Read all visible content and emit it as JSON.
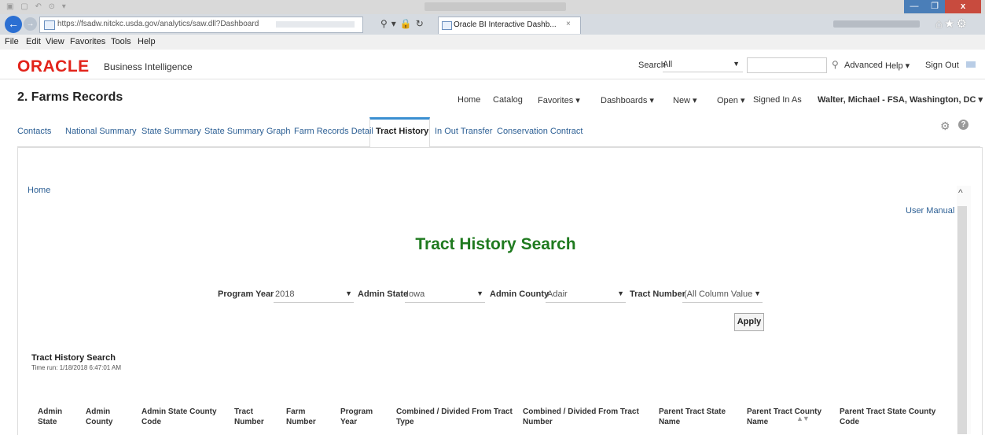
{
  "window": {
    "close_glyph": "x"
  },
  "browser": {
    "url": "https://fsadw.nitckc.usda.gov/analytics/saw.dll?Dashboard",
    "tab_title": "Oracle BI Interactive Dashb...",
    "tab_close": "×"
  },
  "menu": [
    "File",
    "Edit",
    "View",
    "Favorites",
    "Tools",
    "Help"
  ],
  "header": {
    "logo": "ORACLE",
    "product": "Business Intelligence",
    "search_label": "Search",
    "search_scope": "All",
    "advanced": "Advanced",
    "help": "Help ▾",
    "sign_out": "Sign Out"
  },
  "dashboard": {
    "title": "2. Farms Records",
    "nav": {
      "home": "Home",
      "catalog": "Catalog",
      "favorites": "Favorites ▾",
      "dashboards": "Dashboards ▾",
      "new": "New ▾",
      "open": "Open ▾",
      "signed_in_as": "Signed In As",
      "user": "Walter, Michael - FSA, Washington, DC ▾"
    },
    "tabs": [
      "Contacts",
      "National Summary",
      "State Summary",
      "State Summary Graph",
      "Farm Records Detail",
      "Tract History",
      "In Out Transfer",
      "Conservation Contract"
    ],
    "active_tab": "Tract History"
  },
  "content": {
    "breadcrumb": "Home",
    "user_manual": "User Manual",
    "page_title": "Tract History Search",
    "prompts": {
      "program_year_label": "Program Year",
      "program_year_value": "2018",
      "admin_state_label": "Admin State",
      "admin_state_value": "Iowa",
      "admin_county_label": "Admin County",
      "admin_county_value": "Adair",
      "tract_number_label": "Tract Number",
      "tract_number_value": "(All Column Value"
    },
    "apply": "Apply",
    "result_title": "Tract History Search",
    "time_run": "Time run: 1/18/2018 6:47:01 AM",
    "table_headers": [
      [
        "Admin",
        "State"
      ],
      [
        "Admin",
        "County"
      ],
      [
        "Admin State County",
        "Code"
      ],
      [
        "Tract",
        "Number"
      ],
      [
        "Farm",
        "Number"
      ],
      [
        "Program",
        "Year"
      ],
      [
        "Combined / Divided From Tract",
        "Type"
      ],
      [
        "Combined / Divided From Tract",
        "Number"
      ],
      [
        "Parent Tract State",
        "Name"
      ],
      [
        "Parent Tract County",
        "Name"
      ],
      [
        "Parent Tract State County",
        "Code"
      ]
    ]
  }
}
